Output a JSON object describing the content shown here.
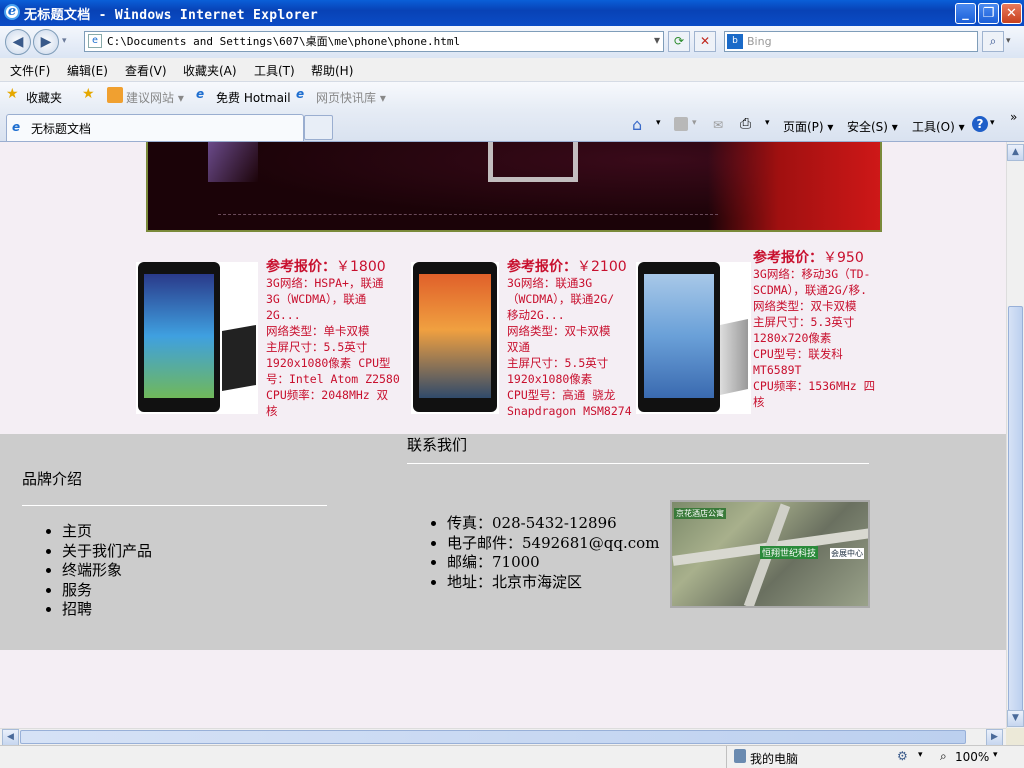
{
  "window": {
    "title": "无标题文档 - Windows Internet Explorer",
    "minimize": "_",
    "restore": "❐",
    "close": "✕"
  },
  "address": {
    "url": "C:\\Documents and Settings\\607\\桌面\\me\\phone\\phone.html",
    "search_placeholder": "Bing"
  },
  "menu": [
    "文件(F)",
    "编辑(E)",
    "查看(V)",
    "收藏夹(A)",
    "工具(T)",
    "帮助(H)"
  ],
  "favorites": {
    "label": "收藏夹",
    "items": [
      "建议网站 ▾",
      "免费 Hotmail",
      "网页快讯库 ▾"
    ]
  },
  "tab": {
    "title": "无标题文档"
  },
  "commands": [
    "页面(P) ▾",
    "安全(S) ▾",
    "工具(O) ▾"
  ],
  "products": [
    {
      "price_label": "参考报价：",
      "price": "￥1800",
      "specs": [
        "3G网络：HSPA+，联通",
        "3G（WCDMA），联通",
        "2G...",
        "网络类型：单卡双模",
        "主屏尺寸：5.5英寸",
        "1920x1080像素 CPU型",
        "号：Intel Atom Z2580",
        "CPU频率：2048MHz 双",
        "核"
      ]
    },
    {
      "price_label": "参考报价：",
      "price": "￥2100",
      "specs": [
        "3G网络：联通3G",
        "（WCDMA），联通2G/",
        "移动2G...",
        "网络类型：双卡双模",
        "双通",
        "主屏尺寸：5.5英寸",
        "1920x1080像素",
        "CPU型号：高通 骁龙",
        "Snapdragon MSM8274"
      ]
    },
    {
      "price_label": "参考报价：",
      "price": "￥950",
      "specs": [
        "3G网络：移动3G（TD-",
        "SCDMA），联通2G/移.",
        "网络类型：双卡双模",
        "主屏尺寸：5.3英寸",
        "1280x720像素",
        "CPU型号：联发科",
        "MT6589T",
        "CPU频率：1536MHz 四",
        "核"
      ]
    }
  ],
  "footer": {
    "brand_heading": "品牌介绍",
    "nav": [
      "主页",
      "关于我们产品",
      "终端形象",
      "服务",
      "招聘"
    ],
    "contact_heading": "联系我们",
    "contact": [
      "传真：028-5432-12896",
      "电子邮件：5492681@qq.com",
      "邮编：71000",
      "地址：北京市海淀区"
    ],
    "map_labels": [
      "京花酒店公寓",
      "恒翔世纪科技",
      "会展中心"
    ]
  },
  "status": {
    "zone": "我的电脑",
    "zoom": "100%"
  },
  "colors": {
    "price_red": "#c8102e",
    "footer_gray": "#cccccc",
    "page_bg": "#f4eef4"
  }
}
